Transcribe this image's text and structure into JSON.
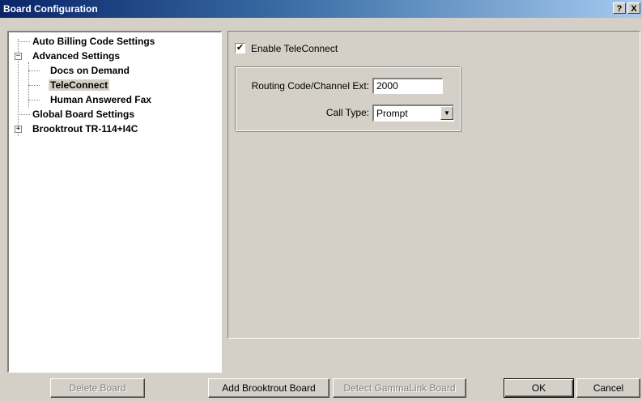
{
  "window": {
    "title": "Board Configuration",
    "help_label": "?",
    "close_label": "X"
  },
  "tree": {
    "items": [
      {
        "label": "Auto Billing Code Settings"
      },
      {
        "label": "Advanced Settings",
        "expander": "−"
      },
      {
        "label": "Docs on Demand"
      },
      {
        "label": "TeleConnect",
        "selected": true
      },
      {
        "label": "Human Answered Fax"
      },
      {
        "label": "Global Board Settings"
      },
      {
        "label": "Brooktrout TR-114+I4C",
        "expander": "+"
      }
    ]
  },
  "panel": {
    "enable_checkbox": {
      "label": "Enable TeleConnect",
      "checked": true,
      "mark": "✔"
    },
    "routing_label": "Routing Code/Channel Ext:",
    "routing_value": "2000",
    "calltype_label": "Call Type:",
    "calltype_value": "Prompt",
    "dropdown_arrow": "▼"
  },
  "buttons": {
    "delete_board": "Delete Board",
    "add_brooktrout": "Add Brooktrout Board",
    "detect_gammalink": "Detect GammaLink Board",
    "ok": "OK",
    "cancel": "Cancel"
  },
  "colors": {
    "title_start": "#0a246a",
    "title_end": "#a6caf0",
    "face": "#d4d0c8"
  }
}
